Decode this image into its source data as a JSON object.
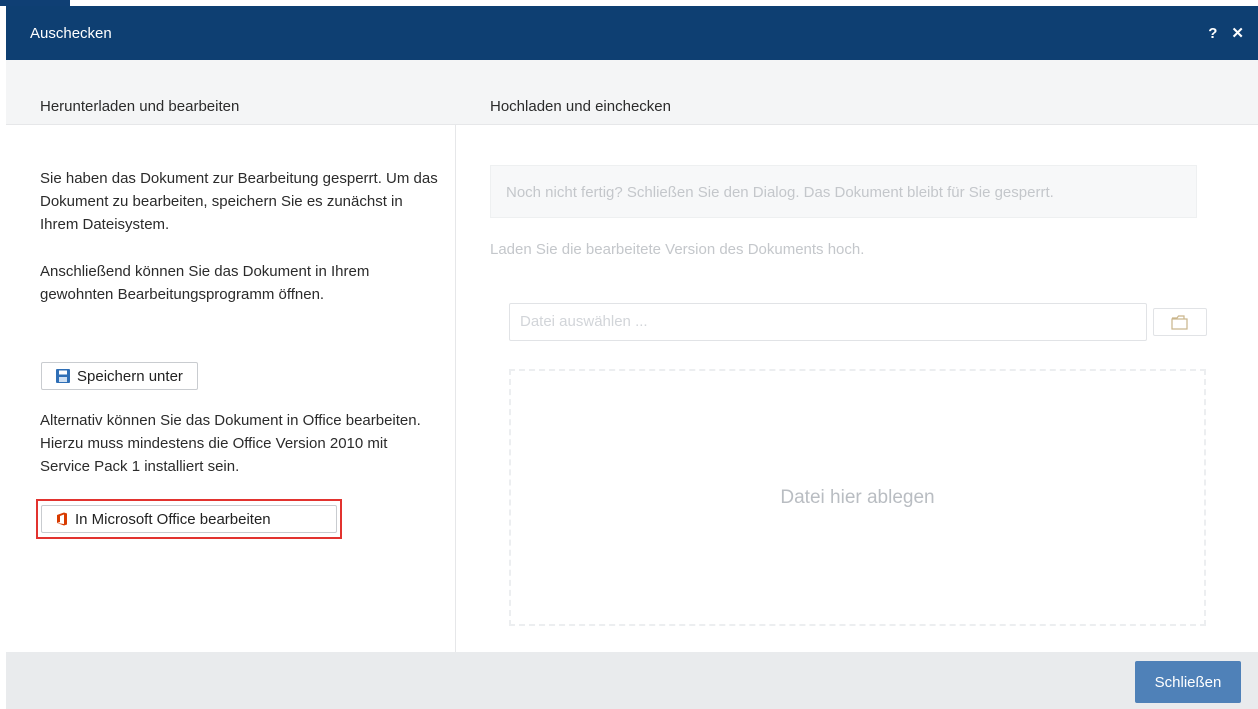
{
  "dialog": {
    "title": "Auschecken",
    "help_label": "?",
    "close_label": "✕"
  },
  "columns": {
    "left_heading": "Herunterladen und bearbeiten",
    "right_heading": "Hochladen und einchecken"
  },
  "left": {
    "para1": "Sie haben das Dokument zur Bearbeitung gesperrt. Um das Dokument zu bearbeiten, speichern Sie es zunächst in Ihrem Dateisystem.",
    "para2": "Anschließend können Sie das Dokument in Ihrem gewohnten Bearbeitungsprogramm öffnen.",
    "save_button": "Speichern unter",
    "para3": "Alternativ können Sie das Dokument in Office bearbeiten. Hierzu muss mindestens die Office Version 2010 mit Service Pack 1 installiert sein.",
    "office_button": "In Microsoft Office bearbeiten"
  },
  "right": {
    "notice": "Noch nicht fertig? Schließen Sie den Dialog. Das Dokument bleibt für Sie gesperrt.",
    "upload_text": "Laden Sie die bearbeitete Version des Dokuments hoch.",
    "file_placeholder": "Datei auswählen ...",
    "dropzone_label": "Datei hier ablegen"
  },
  "footer": {
    "close_button": "Schließen"
  },
  "colors": {
    "titlebar": "#0e3f72",
    "primary_button": "#4f81b8",
    "highlight": "#e2332f",
    "office_icon": "#d83b01",
    "save_icon": "#2f6fb6"
  },
  "icons": {
    "save": "floppy-disk-icon",
    "office": "microsoft-office-icon",
    "browse": "folder-open-icon"
  }
}
